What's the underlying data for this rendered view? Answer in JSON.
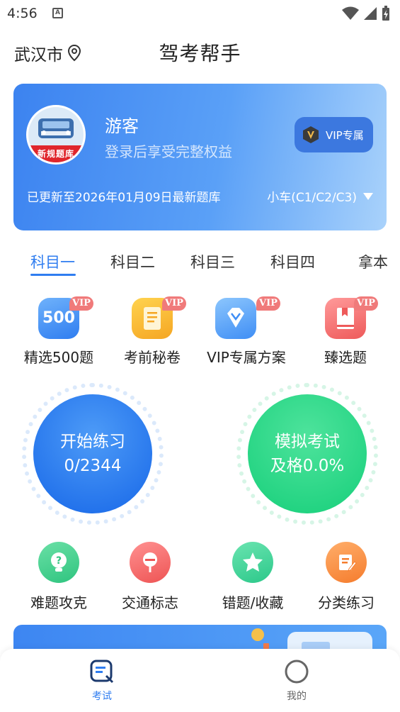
{
  "status_bar": {
    "time": "4:56",
    "notification_icon": "A"
  },
  "header": {
    "city": "武汉市",
    "title": "驾考帮手"
  },
  "banner": {
    "avatar_badge": "新规题库",
    "guest_name": "游客",
    "guest_subtitle": "登录后享受完整权益",
    "vip_button": "VIP专属",
    "update_info": "已更新至2026年01月09日最新题库",
    "car_type": "小车(C1/C2/C3)"
  },
  "tabs": [
    "科目一",
    "科目二",
    "科目三",
    "科目四",
    "拿本"
  ],
  "features": [
    {
      "label": "精选500题",
      "tag": "VIP",
      "icon_text": "500"
    },
    {
      "label": "考前秘卷",
      "tag": "VIP"
    },
    {
      "label": "VIP专属方案",
      "tag": "VIP"
    },
    {
      "label": "臻选题",
      "tag": "VIP"
    }
  ],
  "practice": {
    "title": "开始练习",
    "progress": "0/2344"
  },
  "exam": {
    "title": "模拟考试",
    "pass_rate": "及格0.0%"
  },
  "tools": [
    {
      "label": "难题攻克"
    },
    {
      "label": "交通标志"
    },
    {
      "label": "错题/收藏"
    },
    {
      "label": "分类练习"
    }
  ],
  "bottom_nav": [
    {
      "label": "考试",
      "active": true
    },
    {
      "label": "我的",
      "active": false
    }
  ],
  "colors": {
    "primary": "#2f7df0",
    "banner_start": "#3c83f0",
    "banner_end": "#a9d2fb",
    "practice": "#1f7af0",
    "exam": "#1ed37f",
    "vip_tag": "#f07a7a"
  }
}
